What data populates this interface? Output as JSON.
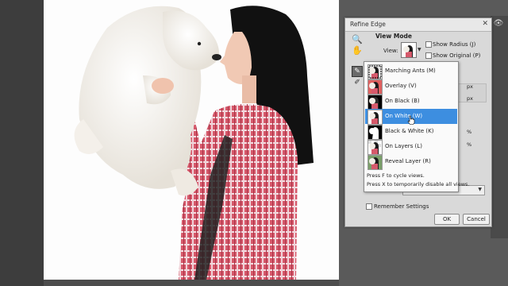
{
  "dialog": {
    "title": "Refine Edge",
    "view_mode": {
      "heading": "View Mode",
      "view_label": "View:",
      "show_radius": "Show Radius (J)",
      "show_original": "Show Original (P)"
    },
    "units": {
      "px1": "px",
      "px2": "px",
      "pct1": "%",
      "pct2": "%"
    },
    "remember_settings": "Remember Settings",
    "ok_label": "OK",
    "cancel_label": "Cancel"
  },
  "view_menu": {
    "items": [
      {
        "label": "Marching Ants (M)",
        "selected": false
      },
      {
        "label": "Overlay (V)",
        "selected": false
      },
      {
        "label": "On Black (B)",
        "selected": false
      },
      {
        "label": "On White (W)",
        "selected": true
      },
      {
        "label": "Black & White (K)",
        "selected": false
      },
      {
        "label": "On Layers (L)",
        "selected": false
      },
      {
        "label": "Reveal Layer (R)",
        "selected": false
      }
    ],
    "hint_cycle": "Press F to cycle views.",
    "hint_disable": "Press X to temporarily disable all views."
  },
  "colors": {
    "selection": "#3d8ee0",
    "dialog_bg": "#d9d9d9",
    "shirt_red": "#c8485a"
  }
}
